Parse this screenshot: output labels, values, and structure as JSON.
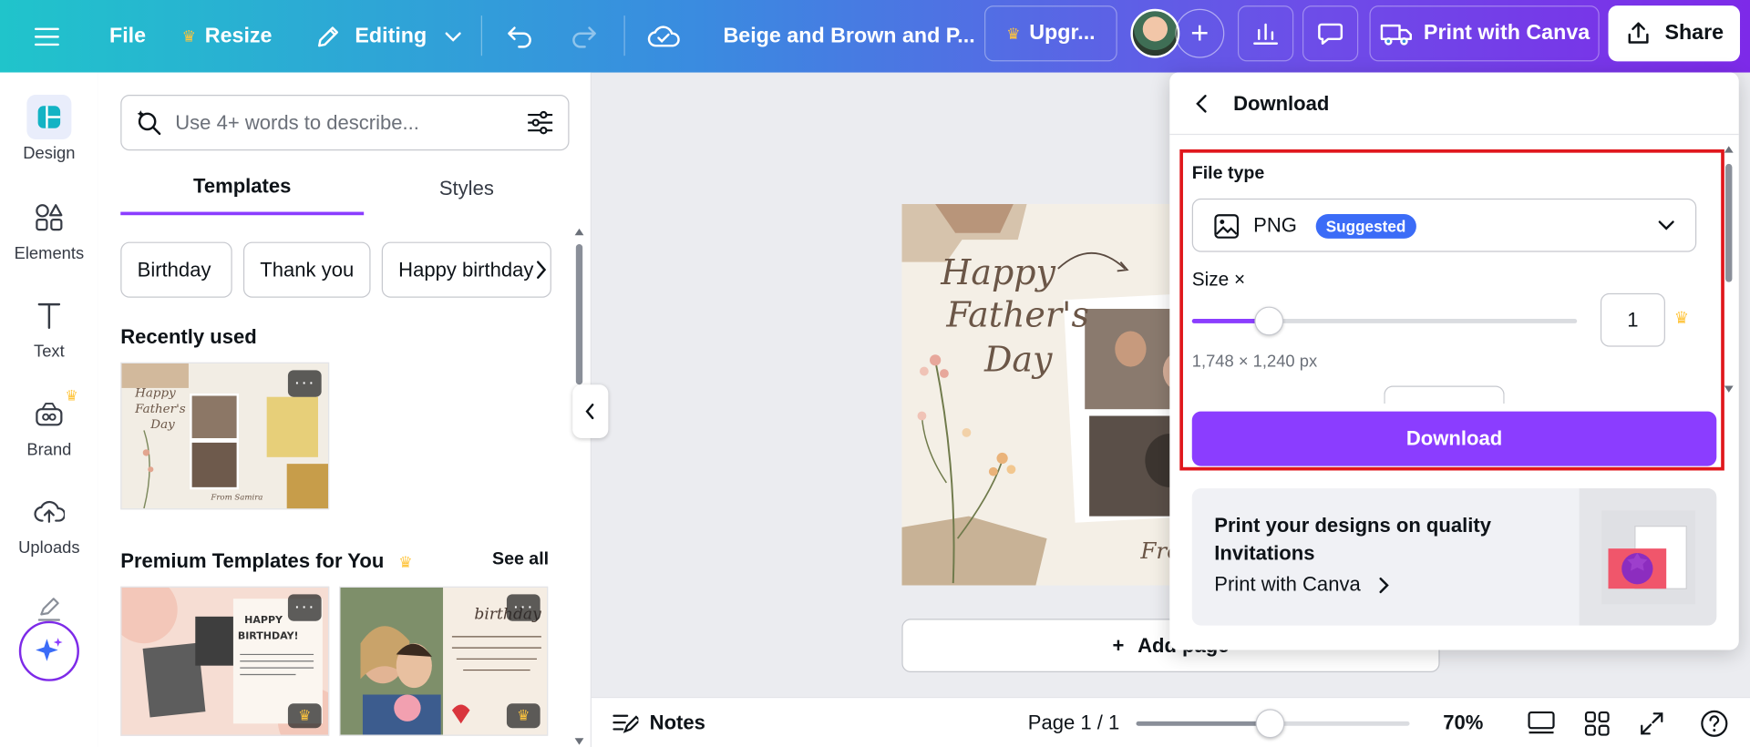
{
  "topbar": {
    "file": "File",
    "resize": "Resize",
    "editing": "Editing",
    "doc_title": "Beige and Brown and P...",
    "upgrade": "Upgr...",
    "print_with_canva": "Print with Canva",
    "share": "Share"
  },
  "rail": {
    "design": "Design",
    "elements": "Elements",
    "text": "Text",
    "brand": "Brand",
    "uploads": "Uploads"
  },
  "panel": {
    "search_placeholder": "Use 4+ words to describe...",
    "tabs": [
      "Templates",
      "Styles"
    ],
    "chips": [
      "Birthday",
      "Thank you",
      "Happy birthday"
    ],
    "recently_used": "Recently used",
    "premium_title": "Premium Templates for You",
    "see_all": "See all"
  },
  "design": {
    "line1": "Happy",
    "line2": "Father's",
    "line3": "Day",
    "from": "Fro"
  },
  "canvas": {
    "add_page": "Add page"
  },
  "bottom": {
    "notes": "Notes",
    "page": "Page 1 / 1",
    "zoom": "70%",
    "zoom_level_percent": 70
  },
  "download": {
    "title": "Download",
    "file_type_label": "File type",
    "file_type": "PNG",
    "suggested": "Suggested",
    "size_label": "Size ×",
    "size_value": "1",
    "size_slider_fraction": 0.2,
    "dimensions": "1,748 × 1,240 px",
    "button": "Download",
    "promo_title": "Print your designs on quality Invitations",
    "promo_link": "Print with Canva"
  },
  "colors": {
    "accent": "#8b3dff",
    "highlight": "#e0171c",
    "badge": "#3b6cf7",
    "crown": "#ffc53d"
  }
}
